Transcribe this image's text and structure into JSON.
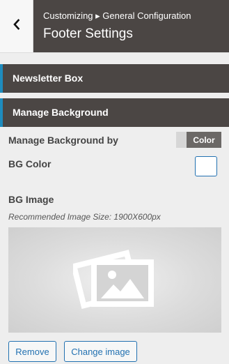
{
  "header": {
    "back_icon": "chevron-left-icon",
    "breadcrumb": "Customizing ▸ General Configuration",
    "title": "Footer Settings"
  },
  "sections": [
    {
      "label": "Newsletter Box"
    },
    {
      "label": "Manage Background"
    }
  ],
  "controls": {
    "manage_background_label": "Manage Background by",
    "toggle_value": "Color",
    "bg_color_label": "BG Color",
    "bg_color_value": "#ffffff",
    "bg_image_label": "BG Image",
    "image_hint": "Recommended Image Size: 1900X600px",
    "image_placeholder_icon": "image-placeholder-icon",
    "remove_label": "Remove",
    "change_label": "Change image"
  },
  "colors": {
    "header_bg": "#4b4644",
    "accent": "#1e8cbe",
    "link": "#2271b1"
  }
}
